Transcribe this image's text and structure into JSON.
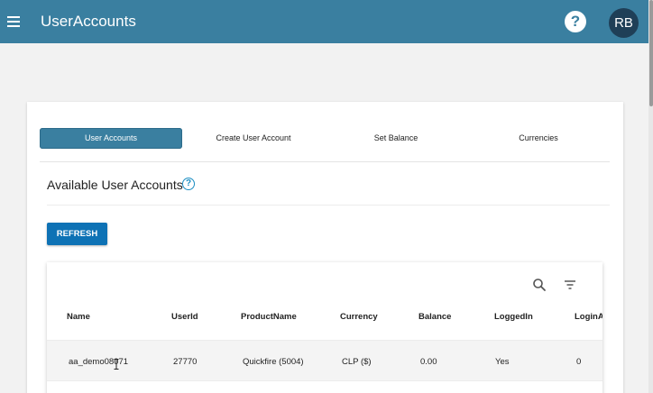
{
  "appbar": {
    "title": "UserAccounts",
    "help_symbol": "?",
    "avatar_initials": "RB",
    "color": "#3a7fa0"
  },
  "tabs": [
    {
      "label": "User Accounts",
      "active": true
    },
    {
      "label": "Create User Account",
      "active": false
    },
    {
      "label": "Set Balance",
      "active": false
    },
    {
      "label": "Currencies",
      "active": false
    }
  ],
  "section": {
    "title": "Available User Accounts",
    "help_symbol": "?"
  },
  "refresh_label": "REFRESH",
  "table": {
    "columns": [
      "Name",
      "UserId",
      "ProductName",
      "Currency",
      "Balance",
      "LoggedIn",
      "LoginA"
    ],
    "rows": [
      [
        "aa_demo08071",
        "27770",
        "Quickfire (5004)",
        "CLP ($)",
        "0.00",
        "Yes",
        "0"
      ]
    ]
  },
  "icons": {
    "menu": "menu-icon",
    "search": "search-icon",
    "filter": "filter-icon"
  },
  "colors": {
    "appbar": "#3a7fa0",
    "active_tab": "#3a7fa0",
    "refresh_button": "#0e72b5",
    "help_link": "#1a8dc2"
  }
}
